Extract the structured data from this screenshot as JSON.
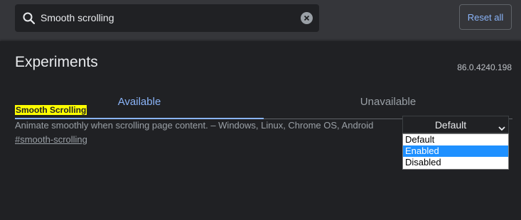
{
  "search": {
    "value": "Smooth scrolling",
    "icon": "search-icon",
    "clear_icon": "close-icon"
  },
  "header": {
    "reset_label": "Reset all"
  },
  "page": {
    "title": "Experiments",
    "version": "86.0.4240.198"
  },
  "tabs": [
    {
      "label": "Available",
      "active": true
    },
    {
      "label": "Unavailable",
      "active": false
    }
  ],
  "flag": {
    "name": "Smooth Scrolling",
    "description": "Animate smoothly when scrolling page content. – Windows, Linux, Chrome OS, Android",
    "link": "#smooth-scrolling",
    "select_value": "Default",
    "options": [
      "Default",
      "Enabled",
      "Disabled"
    ],
    "highlighted_option": "Enabled"
  },
  "colors": {
    "accent": "#8ab4f8",
    "background": "#202124",
    "toolbar": "#35363a",
    "highlight": "#ffff00",
    "option_highlight": "#1e90ff"
  }
}
